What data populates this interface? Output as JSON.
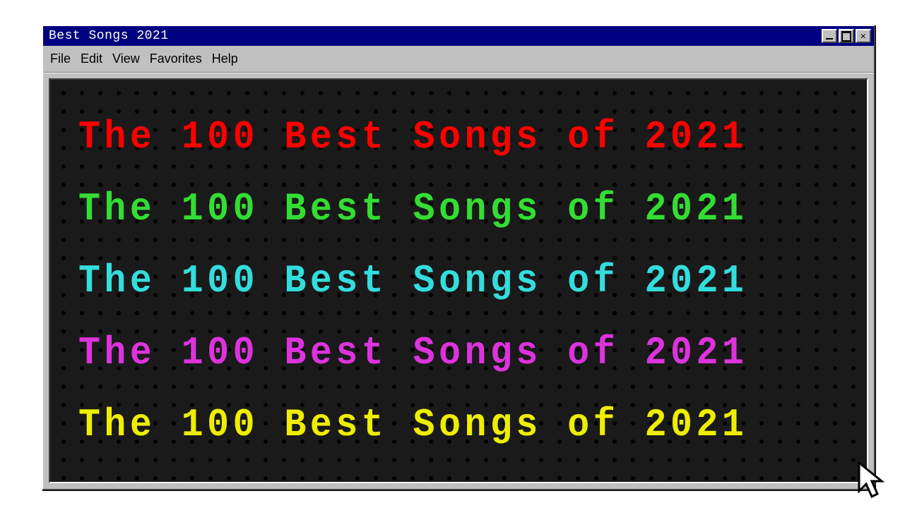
{
  "window": {
    "title": "Best Songs 2021"
  },
  "menubar": {
    "items": [
      {
        "label": "File"
      },
      {
        "label": "Edit"
      },
      {
        "label": "View"
      },
      {
        "label": "Favorites"
      },
      {
        "label": "Help"
      }
    ]
  },
  "content": {
    "headline": "The 100 Best Songs of 2021",
    "lines": [
      {
        "color": "#ff0000"
      },
      {
        "color": "#33dd33"
      },
      {
        "color": "#33dddd"
      },
      {
        "color": "#dd33dd"
      },
      {
        "color": "#eeee00"
      }
    ]
  }
}
